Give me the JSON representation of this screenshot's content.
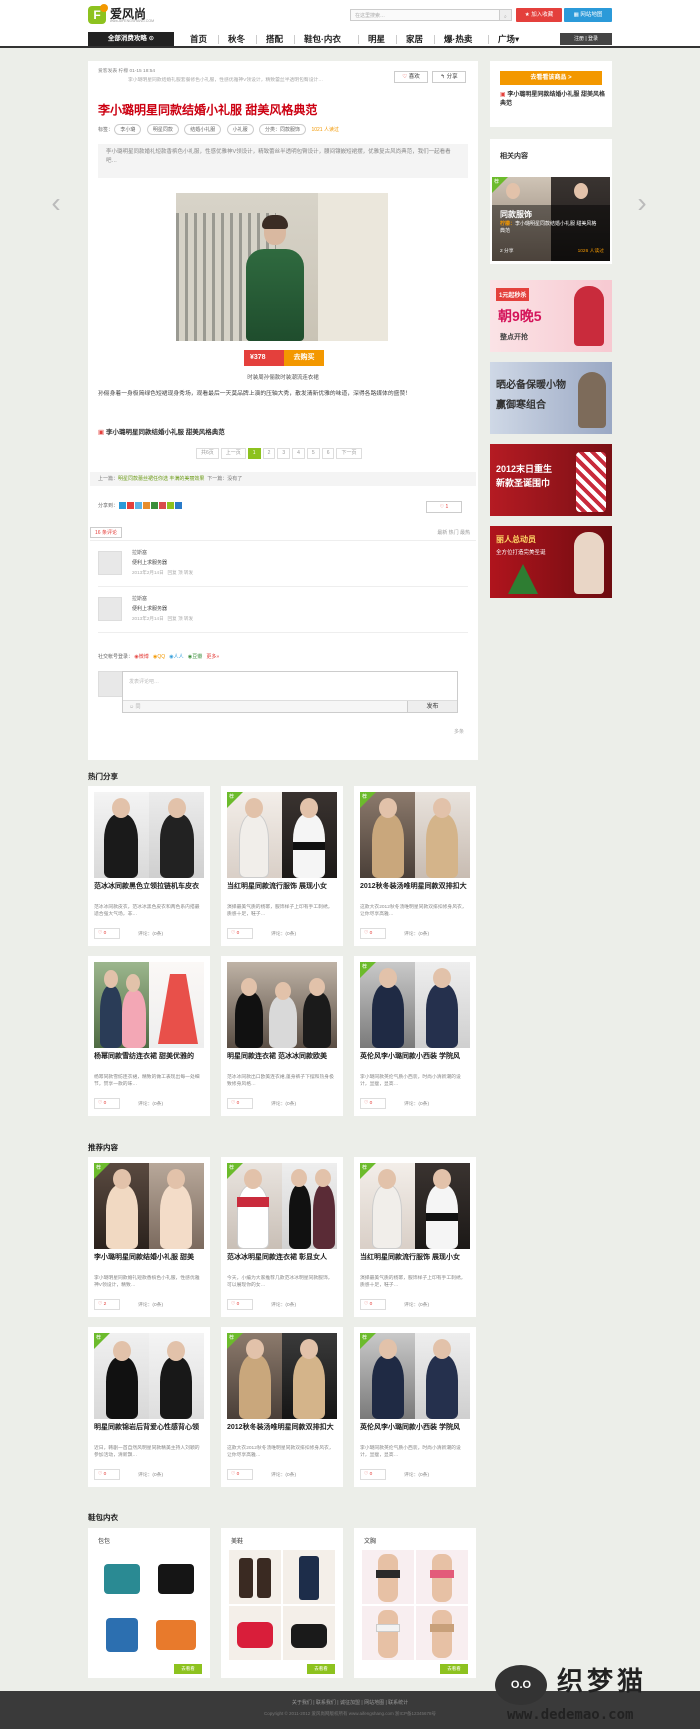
{
  "header": {
    "logo_text": "爱风尚",
    "logo_url": "www.AIFENGSHANG.COM",
    "search_placeholder": "在这里搜索…",
    "fav_label": "加入收藏",
    "map_label": "网站地图"
  },
  "nav": {
    "all_label": "全部消费攻略",
    "items": [
      "首页",
      "秋冬",
      "搭配",
      "鞋包·内衣",
      "明星",
      "家居",
      "爆·热卖",
      "广场"
    ],
    "user_label": "注册 | 登录"
  },
  "article": {
    "author_meta": "爱客发表  柠檬  01-15 18:54",
    "meta_desc": "李小璐明星同款结婚礼服套餐修色小礼服，性感优雅神V领设计，精致蕾丝半透明包臀设计…",
    "like_label": "喜欢",
    "share_label": "分享",
    "title": "李小璐明星同款结婚小礼服 甜美风格典范",
    "tags_label": "标签：",
    "tags": [
      "李小璐",
      "明星同款",
      "结婚小礼服",
      "小礼服"
    ],
    "category": "分类：同款服饰",
    "reads": "1021 人读过",
    "summary": "李小璐明星同款婚礼短款香槟色小礼服，性感优雅神V领设计，精致蕾丝半透明包臀设计，腰间镶嵌短裙摆，优雅复古风尚典范，我们一起看看吧…",
    "price": "¥378",
    "buy_label": "去购买",
    "caption": "时装周孙俪款时装潮流连衣裙",
    "body": "孙俪身着一身极简绿色短裙现身秀场，观看最后一天莫品牌上演的压轴大秀，散发清新优雅的味道，深得各路媒体的盛赞！",
    "sub_title": "李小璐明星同款结婚小礼服 甜美风格典范",
    "pager": [
      "共6页",
      "上一页",
      "1",
      "2",
      "3",
      "4",
      "5",
      "6",
      "下一页"
    ],
    "prev_label": "上一篇：",
    "prev_link": "明星同款蕾丝裙任你选 丰满的美丽效果",
    "next_label": "下一篇：没有了",
    "share_to": "分享到：",
    "like_count": "1"
  },
  "comments": {
    "count_label": "16 条评论",
    "sort": "最新  热门  最热",
    "items": [
      {
        "name": "拉斯塞",
        "text": "便利上求服务器",
        "date": "2013年2月14日",
        "actions": "回复  顶  转发"
      },
      {
        "name": "拉斯塞",
        "text": "便利上求服务器",
        "date": "2013年2月14日",
        "actions": "回复  顶  转发"
      }
    ],
    "social_label": "社交帐号登录：",
    "social": [
      "微博",
      "QQ",
      "人人",
      "豆瓣",
      "更多»"
    ],
    "placeholder": "发表评论吧…",
    "post_label": "发布",
    "bar_hint": "☺ 同",
    "more_label": "多条"
  },
  "sidebar": {
    "buy_label": "去看看该商品 >",
    "product_title": "李小璐明星同款结婚小礼服 甜美风格典范",
    "related_title": "相关内容",
    "related_cat": "同款服饰",
    "related_author": "柠檬：",
    "related_desc": "李小璐明星同款结婚小礼服 甜美风格典范",
    "related_foot_left": "2 分享",
    "related_foot_right": "1026 人读过",
    "ads": [
      {
        "t1": "1元起秒杀",
        "t2": "朝9晚5",
        "t3": "整点开抢"
      },
      {
        "t1": "晒必备保暖小物",
        "t2": "赢御寒组合",
        "t3": ""
      },
      {
        "t1": "2012末日重生",
        "t2": "新款圣诞围巾",
        "t3": ""
      },
      {
        "t1": "丽人总动员",
        "t2": "全方位打造完美圣诞",
        "t3": ""
      }
    ]
  },
  "hot": {
    "title": "热门分享",
    "items": [
      {
        "title": "范冰冰同款黑色立领拉链机车皮衣",
        "desc": "范冰冰同款皮衣，范冰冰黑色皮衣和两色系内搭最适合强大气场，非…",
        "likes": "0",
        "cmt": "评论：(0条)"
      },
      {
        "title": "当红明星同款流行服饰 展现小女",
        "desc": "演绎最美气质的杨幂，服饰样子上印有手工刺绣，质感十足，鞋子…",
        "likes": "0",
        "cmt": "评论：(0条)"
      },
      {
        "title": "2012秋冬装汤唯明星同款双排扣大",
        "desc": "这款大衣2012秋冬汤唯明星同款双排扣修身风衣，让你尽享高雅…",
        "likes": "0",
        "cmt": "评论：(0条)"
      },
      {
        "title": "杨幂同款雪纺连衣裙 甜美优雅的",
        "desc": "杨幂同款雪纺连衣裙，精致的做工表现出每一处细节，赞享一款的味…",
        "likes": "0",
        "cmt": "评论：(0条)"
      },
      {
        "title": "明星同款连衣裙 范冰冰同款欧美",
        "desc": "范冰冰同款出口欧美连衣裙,蓬身裤子下摆和热身极致修身风格…",
        "likes": "0",
        "cmt": "评论：(0条)"
      },
      {
        "title": "英伦风李小璐同款小西装 学院风",
        "desc": "李小璐同款英伦气质小西装，时尚小清新潮的设计，显瘦，显高…",
        "likes": "0",
        "cmt": "评论：(0条)"
      }
    ]
  },
  "recommend": {
    "title": "推荐内容",
    "items": [
      {
        "title": "李小璐明星同款结婚小礼服 甜美",
        "desc": "李小璐明星同款婚礼短款香槟色小礼服，性感优雅神V领设计，精致…",
        "likes": "2",
        "cmt": "评论：(0条)"
      },
      {
        "title": "范冰冰明星同款连衣裙 彰显女人",
        "desc": "今天，小编为大家推荐几款范冰冰明星同款服饰，可以展现你的女…",
        "likes": "0",
        "cmt": "评论：(0条)"
      },
      {
        "title": "当红明星同款流行服饰 展现小女",
        "desc": "演绎最美气质的杨幂，服饰样子上印有手工刺绣，质感十足，鞋子…",
        "likes": "0",
        "cmt": "评论：(0条)"
      },
      {
        "title": "明星同款锦岩后背爱心性感背心领",
        "desc": "近日，韩剧一首自然风明星同款精美主持人刘颖的参加活动，清新飘…",
        "likes": "0",
        "cmt": "评论：(0条)"
      },
      {
        "title": "2012秋冬装汤唯明星同款双排扣大",
        "desc": "这款大衣2012秋冬汤唯明星同款双排扣修身风衣，让你尽享高雅…",
        "likes": "0",
        "cmt": "评论：(0条)"
      },
      {
        "title": "英伦风李小璐同款小西装 学院风",
        "desc": "李小璐同款英伦气质小西装，时尚小清新潮的设计，显瘦，显高…",
        "likes": "0",
        "cmt": "评论：(0条)"
      }
    ]
  },
  "bags": {
    "title": "鞋包内衣",
    "cats": [
      {
        "name": "包包",
        "btn": "去看看"
      },
      {
        "name": "美鞋",
        "btn": "去看看"
      },
      {
        "name": "文胸",
        "btn": "去看看"
      }
    ]
  },
  "footer": {
    "links": "关于我们  |  联系我们  |  诚征加盟  |  网站地图  |  联系统计",
    "copy": "Copyright © 2011-2012  爱风尚网版权所有  www.aifengshang.com  浙ICP备12345678号"
  },
  "watermark": {
    "cat": "O.O",
    "name": "织梦猫",
    "url": "www.dedemao.com"
  },
  "colors": {
    "accent": "#8dc21f",
    "red": "#e4403c",
    "orange": "#f39800"
  }
}
